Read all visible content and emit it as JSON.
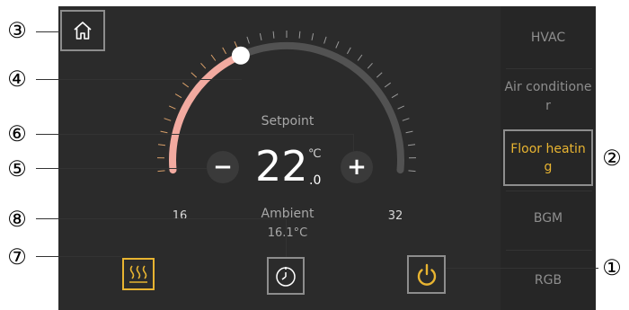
{
  "callouts": {
    "c1": "①",
    "c2": "②",
    "c3": "③",
    "c4": "④",
    "c5": "⑤",
    "c6": "⑥",
    "c7": "⑦",
    "c8": "⑧"
  },
  "sidebar": {
    "items": [
      {
        "label": "HVAC"
      },
      {
        "label": "Air conditioner"
      },
      {
        "label": "Floor heating"
      },
      {
        "label": "BGM"
      },
      {
        "label": "RGB"
      }
    ]
  },
  "dial": {
    "setpoint_label": "Setpoint",
    "temp_int": "22",
    "temp_unit": "℃",
    "temp_dec": ".0",
    "min_label": "16",
    "max_label": "32",
    "ambient_label": "Ambient",
    "ambient_value": "16.1°C",
    "minus": "−",
    "plus": "+",
    "setpoint_fraction": 0.375
  },
  "colors": {
    "active_orange": "#e8b431",
    "arc_active": "#f2aaa0",
    "arc_inactive": "#525252",
    "panel": "#2b2b2b"
  },
  "icons": {
    "home": "home-icon",
    "heating": "floor-heating-icon",
    "timer": "clock-icon",
    "power": "power-icon"
  }
}
